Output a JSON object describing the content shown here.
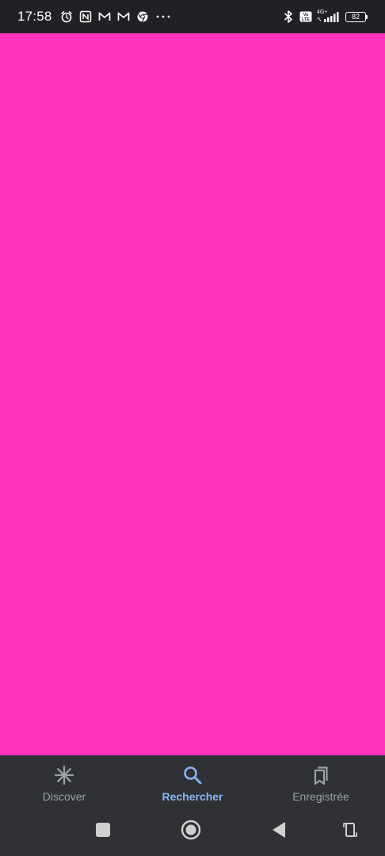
{
  "status_bar": {
    "time": "17:58",
    "battery": "82",
    "network": "4G+",
    "volte": "Vo LTE"
  },
  "content": {
    "background_color": "#ff33bb"
  },
  "bottom_nav": {
    "items": [
      {
        "label": "Discover",
        "icon": "asterisk-icon",
        "active": false
      },
      {
        "label": "Rechercher",
        "icon": "search-icon",
        "active": true
      },
      {
        "label": "Enregistrée",
        "icon": "bookmarks-icon",
        "active": false
      }
    ]
  },
  "system_nav": {
    "buttons": [
      "recents-square-icon",
      "home-circle-icon",
      "back-triangle-icon",
      "rotate-icon"
    ]
  },
  "colors": {
    "accent": "#8ab4f8",
    "nav_inactive": "#9aa0a6",
    "nav_background": "#303134",
    "status_background": "#202124"
  }
}
